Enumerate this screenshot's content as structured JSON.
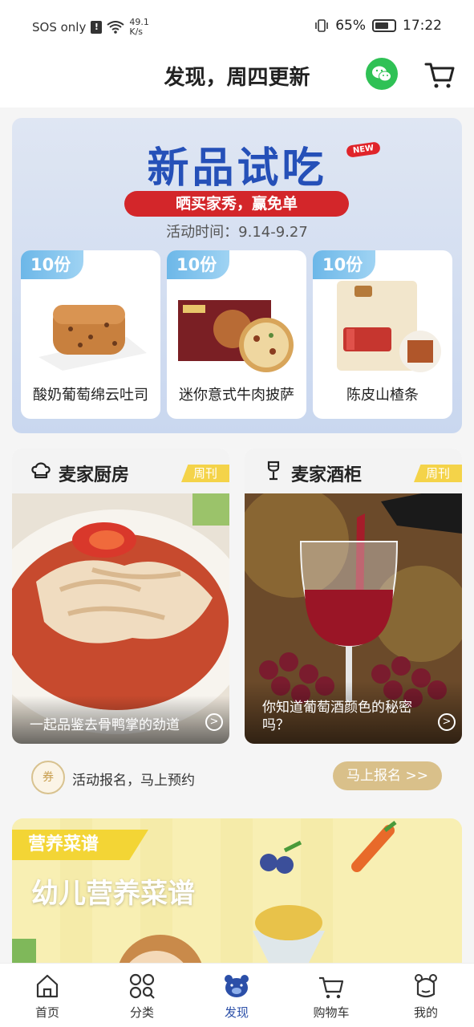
{
  "status_bar": {
    "carrier": "SOS only",
    "sos_mark": "!",
    "net_speed": "49.1",
    "net_unit": "K/s",
    "battery": "65%",
    "time": "17:22"
  },
  "header": {
    "title": "发现，周四更新"
  },
  "banner": {
    "title": "新品试吃",
    "badge": "NEW",
    "slogan": "晒买家秀，赢免单",
    "period": "活动时间：9.14-9.27",
    "products": [
      {
        "qty": "10份",
        "name": "酸奶葡萄绵云吐司"
      },
      {
        "qty": "10份",
        "name": "迷你意式牛肉披萨"
      },
      {
        "qty": "10份",
        "name": "陈皮山楂条"
      }
    ]
  },
  "cards": [
    {
      "title": "麦家厨房",
      "badge": "周刊",
      "caption": "一起品鉴去骨鸭掌的劲道"
    },
    {
      "title": "麦家酒柜",
      "badge": "周刊",
      "caption": "你知道葡萄酒颜色的秘密吗？"
    }
  ],
  "activity": {
    "icon_text": "券",
    "text": "活动报名，马上预约",
    "button": "马上报名 >>"
  },
  "recipe": {
    "tag": "营养菜谱",
    "title": "幼儿营养菜谱"
  },
  "nav": [
    {
      "label": "首页",
      "icon": "home-icon"
    },
    {
      "label": "分类",
      "icon": "category-icon"
    },
    {
      "label": "发现",
      "icon": "discover-bear-icon"
    },
    {
      "label": "购物车",
      "icon": "cart-icon"
    },
    {
      "label": "我的",
      "icon": "profile-icon"
    }
  ],
  "colors": {
    "accent_blue": "#2550b8",
    "red": "#d3262a",
    "wechat_green": "#2fc155",
    "gold": "#d9c08a",
    "yellow": "#f3d535"
  }
}
